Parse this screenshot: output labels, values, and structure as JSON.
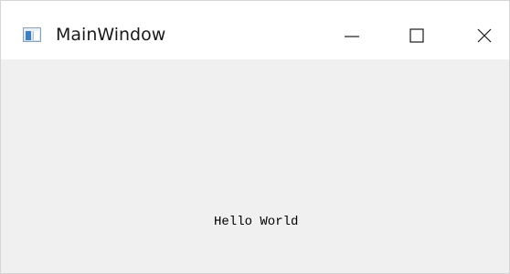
{
  "window": {
    "title": "MainWindow",
    "controls": {
      "minimize": "minimize-icon",
      "maximize": "maximize-icon",
      "close": "close-icon"
    }
  },
  "content": {
    "label": "Hello World"
  },
  "colors": {
    "titlebar_bg": "#ffffff",
    "client_bg": "#f0f0f0",
    "text": "#000000"
  }
}
